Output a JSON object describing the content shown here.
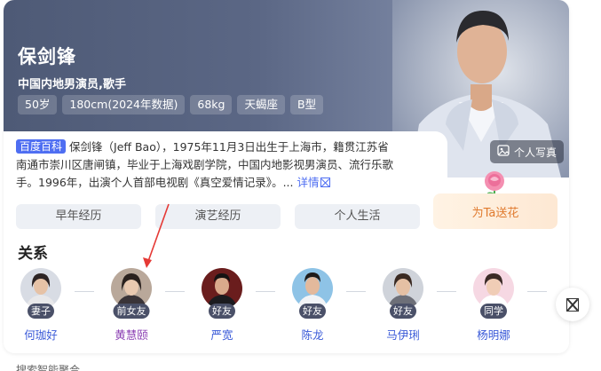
{
  "person": {
    "name": "保剑锋",
    "occupation": "中国内地男演员,歌手",
    "tags": [
      "50岁",
      "180cm(2024年数据)",
      "68kg",
      "天蝎座",
      "B型"
    ]
  },
  "intro": {
    "source_badge": "百度百科",
    "text": "保剑锋（Jeff Bao），1975年11月3日出生于上海市，籍贯江苏省南通市崇川区唐闸镇，毕业于上海戏剧学院，中国内地影视男演员、流行乐歌手。1996年，出演个人首部电视剧《真空爱情记录》。...",
    "more_label": "详情"
  },
  "photo_button_label": "个人写真",
  "flower_button_label": "为Ta送花",
  "tabs": [
    "早年经历",
    "演艺经历",
    "个人生活"
  ],
  "relations_title": "关系",
  "relations": [
    {
      "relation": "妻子",
      "name": "何珈好"
    },
    {
      "relation": "前女友",
      "name": "黄慧颐"
    },
    {
      "relation": "好友",
      "name": "严宽"
    },
    {
      "relation": "好友",
      "name": "陈龙"
    },
    {
      "relation": "好友",
      "name": "马伊琍"
    },
    {
      "relation": "同学",
      "name": "杨明娜"
    }
  ],
  "footer_peek": "搜索智能聚合",
  "icons": {
    "photo": "image-icon",
    "more": "external-link-icon",
    "flower": "rose-icon",
    "next": "next-arrow-icon",
    "annotation": "red-arrow-icon"
  },
  "colors": {
    "accent": "#4e6ef2",
    "relation_name": "#3a5ad8",
    "visited_name": "#8b3fb3",
    "flower_text": "#e07a2e",
    "annotation_arrow": "#e53935"
  }
}
